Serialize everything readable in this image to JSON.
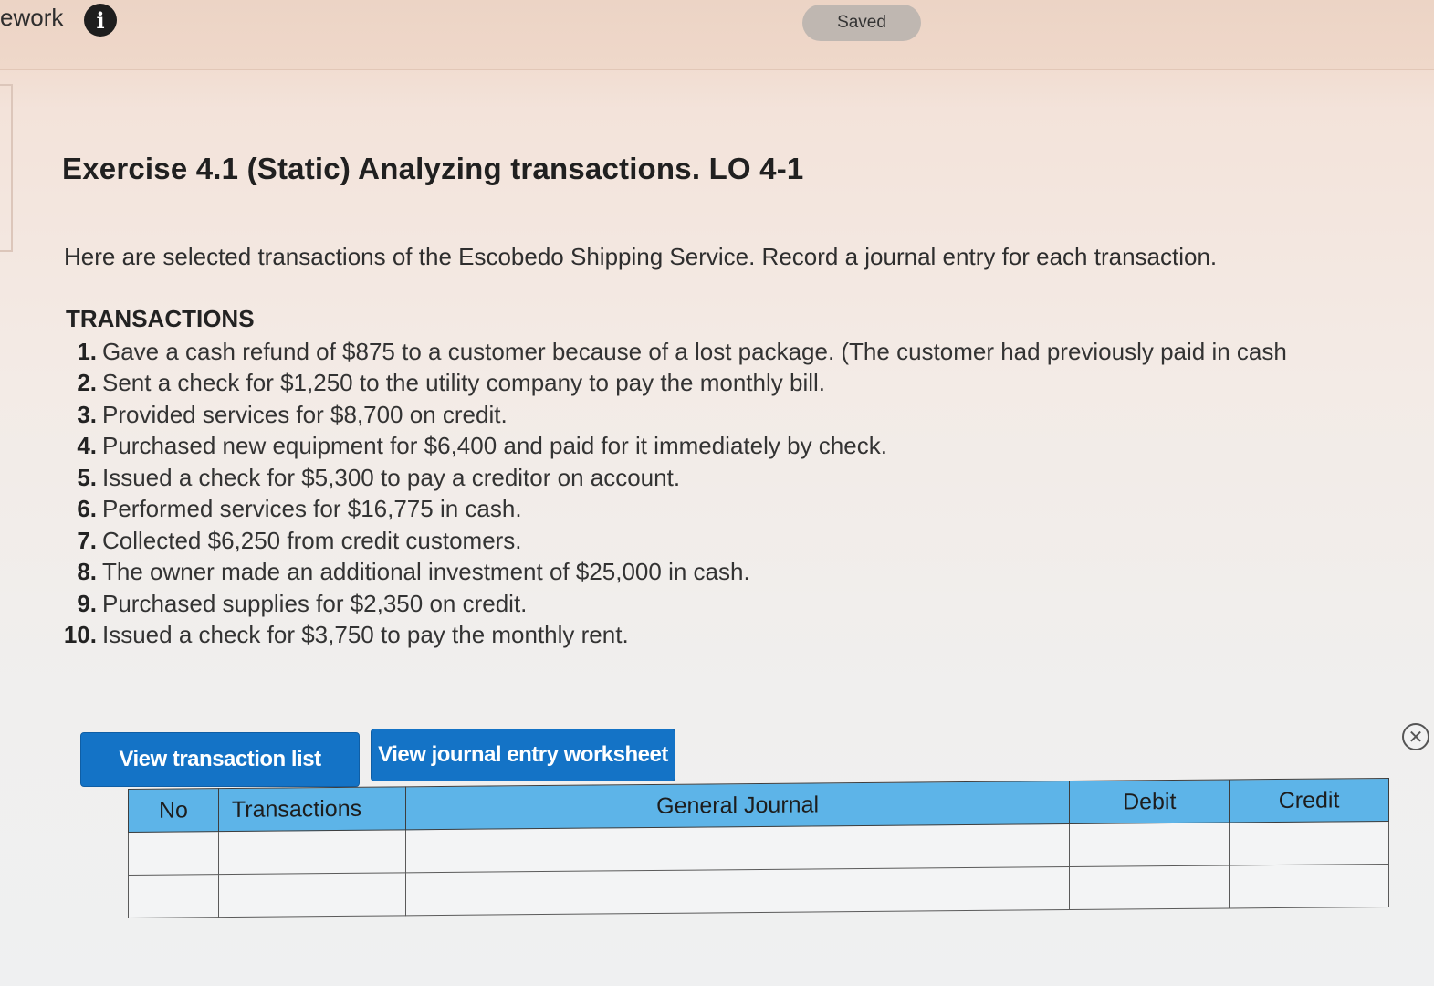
{
  "header": {
    "brand_fragment": "ework",
    "info_icon": "info-icon",
    "saved_label": "Saved"
  },
  "exercise": {
    "title": "Exercise 4.1 (Static) Analyzing transactions. LO 4-1",
    "intro": "Here are selected transactions of the Escobedo Shipping Service. Record a journal entry for each transaction.",
    "transactions_heading": "TRANSACTIONS",
    "transactions": [
      {
        "num": "1.",
        "text": "Gave a cash refund of $875 to a customer because of a lost package. (The customer had previously paid in cash"
      },
      {
        "num": "2.",
        "text": "Sent a check for $1,250 to the utility company to pay the monthly bill."
      },
      {
        "num": "3.",
        "text": "Provided services for $8,700 on credit."
      },
      {
        "num": "4.",
        "text": "Purchased new equipment for $6,400 and paid for it immediately by check."
      },
      {
        "num": "5.",
        "text": "Issued a check for $5,300 to pay a creditor on account."
      },
      {
        "num": "6.",
        "text": "Performed services for $16,775 in cash."
      },
      {
        "num": "7.",
        "text": "Collected $6,250 from credit customers."
      },
      {
        "num": "8.",
        "text": "The owner made an additional investment of $25,000 in cash."
      },
      {
        "num": "9.",
        "text": "Purchased supplies for $2,350 on credit."
      },
      {
        "num": "10.",
        "text": "Issued a check for $3,750 to pay the monthly rent."
      }
    ]
  },
  "buttons": {
    "view_transaction_list": "View transaction list",
    "view_journal_entry_worksheet": "View journal entry worksheet",
    "close_icon": "close-icon"
  },
  "journal_table": {
    "headers": {
      "no": "No",
      "transactions": "Transactions",
      "general_journal": "General Journal",
      "debit": "Debit",
      "credit": "Credit"
    },
    "rows": [
      {
        "no": "",
        "transaction": "",
        "general_journal": "",
        "debit": "",
        "credit": ""
      },
      {
        "no": "",
        "transaction": "",
        "general_journal": "",
        "debit": "",
        "credit": ""
      }
    ]
  },
  "colors": {
    "button_blue": "#1473c6",
    "table_header_blue": "#5db4e8"
  }
}
